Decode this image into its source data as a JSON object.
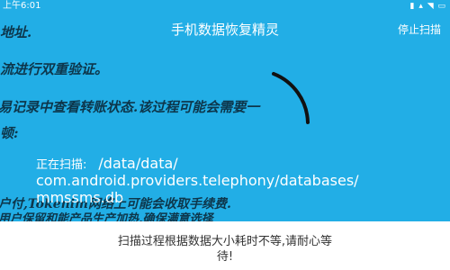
{
  "status_bar": {
    "time": "上午6:01",
    "icons": "▮ ▴ ◥ ▭"
  },
  "header": {
    "title": "手机数据恢复精灵",
    "stop_label": "停止扫描"
  },
  "background_text": [
    "地址.",
    "流进行双重验证。",
    "易记录中查看转账状态.该过程可能会需要一",
    "顿:",
    "户付,Tokenim网络上可能会收取手续费.",
    "用户保留和能产品生产加热,确保满意选择"
  ],
  "scan": {
    "label": "正在扫描:",
    "path": "/data/data/\ncom.android.providers.telephony/databases/\nmmssms.db"
  },
  "footer": {
    "notice": "扫描过程根据数据大小耗时不等,请耐心等\n待!"
  }
}
